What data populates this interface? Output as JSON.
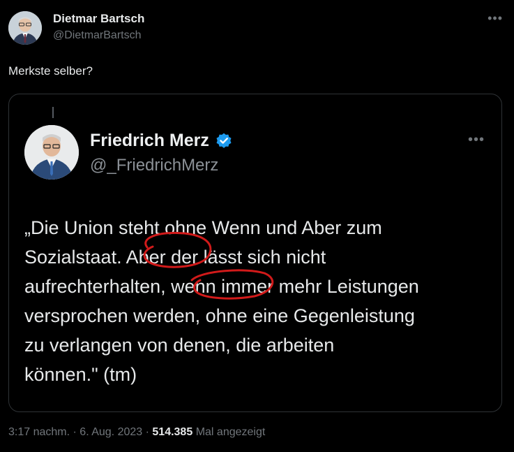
{
  "author": {
    "name": "Dietmar Bartsch",
    "handle": "@DietmarBartsch"
  },
  "tweet": {
    "text": "Merkste selber?"
  },
  "quoted": {
    "name": "Friedrich Merz",
    "handle": "@_FriedrichMerz",
    "verified_color": "#1d9bf0",
    "lines": [
      "„Die Union steht ohne Wenn und Aber zum",
      "Sozialstaat. Aber der lässt sich nicht",
      "aufrechterhalten, wenn immer mehr Leistungen",
      "versprochen werden, ohne eine Gegenleistung",
      "zu verlangen von denen, die arbeiten",
      "können.\" (tm)"
    ],
    "highlight_color": "#d11a1a"
  },
  "footer": {
    "time": "3:17 nachm.",
    "separator": "·",
    "date": "6. Aug. 2023",
    "views_count": "514.385",
    "views_label": "Mal angezeigt"
  },
  "icons": {
    "more": "more-icon",
    "verified": "verified-icon"
  },
  "colors": {
    "background": "#000000",
    "text": "#e7e9ea",
    "secondary": "#71767b",
    "border": "#2f3336"
  }
}
